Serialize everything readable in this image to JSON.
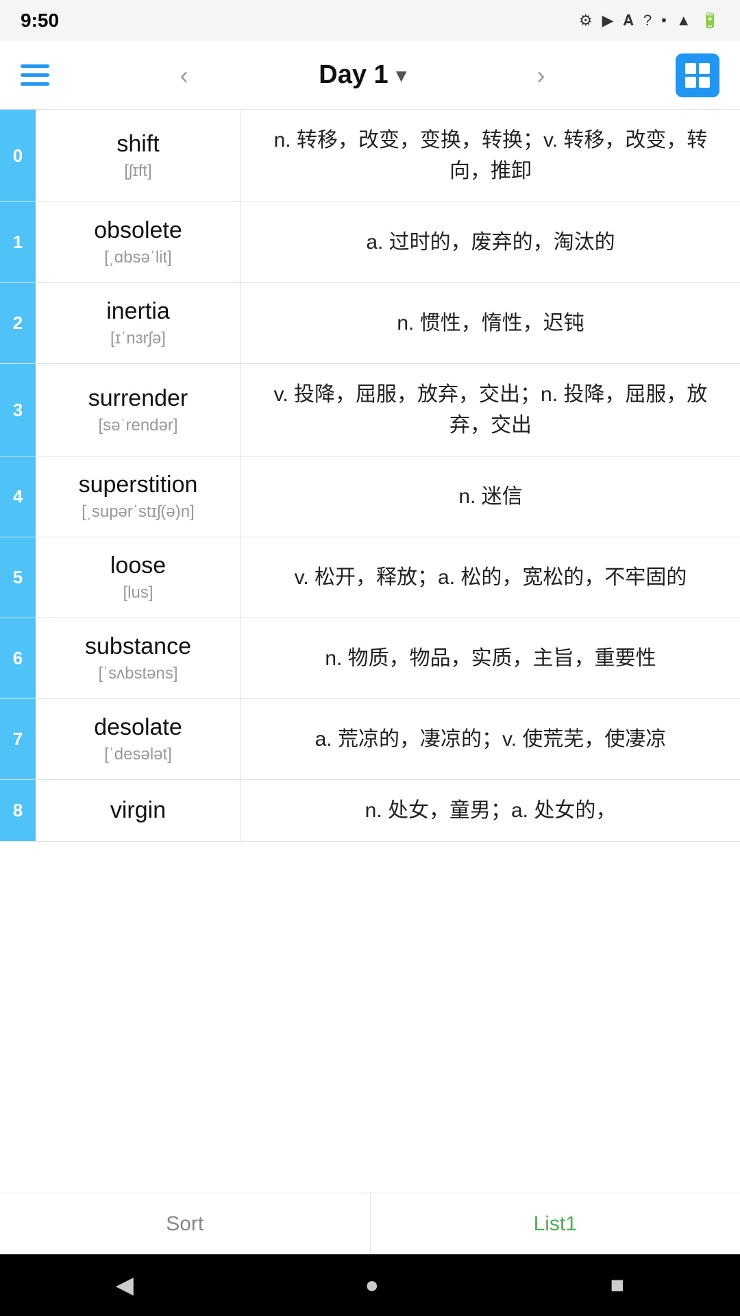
{
  "statusBar": {
    "time": "9:50",
    "icons": [
      "gear",
      "play-circle",
      "font",
      "wifi",
      "dot",
      "signal",
      "battery"
    ]
  },
  "navBar": {
    "title": "Day 1",
    "chevron": "▾",
    "prevArrow": "‹",
    "nextArrow": "›"
  },
  "words": [
    {
      "index": "0",
      "word": "shift",
      "phonetic": "[ʃɪft]",
      "definition": "n. 转移，改变，变换，转换；v. 转移，改变，转向，推卸"
    },
    {
      "index": "1",
      "word": "obsolete",
      "phonetic": "[ˌɑbsəˈlit]",
      "definition": "a. 过时的，废弃的，淘汰的"
    },
    {
      "index": "2",
      "word": "inertia",
      "phonetic": "[ɪˈnɜrʃə]",
      "definition": "n. 惯性，惰性，迟钝"
    },
    {
      "index": "3",
      "word": "surrender",
      "phonetic": "[səˈrendər]",
      "definition": "v. 投降，屈服，放弃，交出；n. 投降，屈服，放弃，交出"
    },
    {
      "index": "4",
      "word": "superstition",
      "phonetic": "[ˌsupərˈstɪʃ(ə)n]",
      "definition": "n. 迷信"
    },
    {
      "index": "5",
      "word": "loose",
      "phonetic": "[lus]",
      "definition": "v. 松开，释放；a. 松的，宽松的，不牢固的"
    },
    {
      "index": "6",
      "word": "substance",
      "phonetic": "[ˈsʌbstəns]",
      "definition": "n. 物质，物品，实质，主旨，重要性"
    },
    {
      "index": "7",
      "word": "desolate",
      "phonetic": "[ˈdesələt]",
      "definition": "a. 荒凉的，凄凉的；v. 使荒芜，使凄凉"
    },
    {
      "index": "8",
      "word": "virgin",
      "phonetic": "",
      "definition": "n. 处女，童男；a. 处女的，"
    }
  ],
  "bottomTabs": {
    "sortLabel": "Sort",
    "list1Label": "List1"
  },
  "androidNav": {
    "back": "◀",
    "home": "●",
    "recent": "■"
  }
}
